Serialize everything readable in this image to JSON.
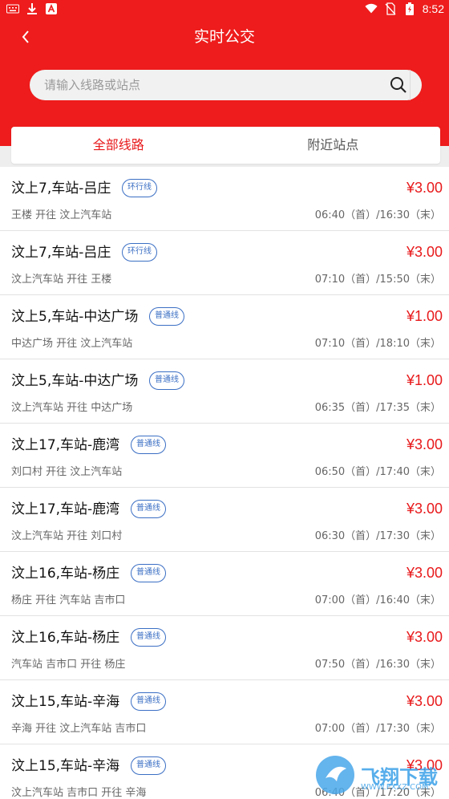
{
  "status_bar": {
    "time": "8:52"
  },
  "header": {
    "title": "实时公交"
  },
  "search": {
    "placeholder": "请输入线路或站点"
  },
  "tabs": [
    {
      "label": "全部线路",
      "active": true
    },
    {
      "label": "附近站点",
      "active": false
    }
  ],
  "routes": [
    {
      "name": "汶上7,车站-吕庄",
      "type": "环行线",
      "price": "¥3.00",
      "direction": "王楼 开往 汶上汽车站",
      "time": "06:40（首）/16:30（末）"
    },
    {
      "name": "汶上7,车站-吕庄",
      "type": "环行线",
      "price": "¥3.00",
      "direction": "汶上汽车站 开往 王楼",
      "time": "07:10（首）/15:50（末）"
    },
    {
      "name": "汶上5,车站-中达广场",
      "type": "普通线",
      "price": "¥1.00",
      "direction": "中达广场 开往 汶上汽车站",
      "time": "07:10（首）/18:10（末）"
    },
    {
      "name": "汶上5,车站-中达广场",
      "type": "普通线",
      "price": "¥1.00",
      "direction": "汶上汽车站 开往 中达广场",
      "time": "06:35（首）/17:35（末）"
    },
    {
      "name": "汶上17,车站-鹿湾",
      "type": "普通线",
      "price": "¥3.00",
      "direction": "刘口村 开往 汶上汽车站",
      "time": "06:50（首）/17:40（末）"
    },
    {
      "name": "汶上17,车站-鹿湾",
      "type": "普通线",
      "price": "¥3.00",
      "direction": "汶上汽车站 开往 刘口村",
      "time": "06:30（首）/17:30（末）"
    },
    {
      "name": "汶上16,车站-杨庄",
      "type": "普通线",
      "price": "¥3.00",
      "direction": "杨庄 开往 汽车站 吉市口",
      "time": "07:00（首）/16:40（末）"
    },
    {
      "name": "汶上16,车站-杨庄",
      "type": "普通线",
      "price": "¥3.00",
      "direction": "汽车站 吉市口 开往 杨庄",
      "time": "07:50（首）/16:30（末）"
    },
    {
      "name": "汶上15,车站-辛海",
      "type": "普通线",
      "price": "¥3.00",
      "direction": "辛海 开往 汶上汽车站 吉市口",
      "time": "07:00（首）/17:30（末）"
    },
    {
      "name": "汶上15,车站-辛海",
      "type": "普通线",
      "price": "¥3.00",
      "direction": "汶上汽车站 吉市口 开往 辛海",
      "time": "06:40（首）/17:20（末）"
    }
  ],
  "watermark": {
    "text": "飞翔下载",
    "url": "WWW.FXXZ.COM"
  },
  "colors": {
    "header": "#ee1c1c",
    "accent": "#e8191b",
    "badge": "#3b6fc4"
  }
}
